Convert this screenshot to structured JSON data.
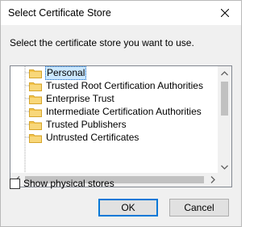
{
  "window": {
    "title": "Select Certificate Store",
    "close_glyph": "✕"
  },
  "prompt": "Select the certificate store you want to use.",
  "tree": {
    "items": [
      {
        "label": "Personal",
        "selected": true,
        "icon": "folder-icon"
      },
      {
        "label": "Trusted Root Certification Authorities",
        "selected": false,
        "icon": "folder-icon"
      },
      {
        "label": "Enterprise Trust",
        "selected": false,
        "icon": "folder-icon"
      },
      {
        "label": "Intermediate Certification Authorities",
        "selected": false,
        "icon": "folder-icon"
      },
      {
        "label": "Trusted Publishers",
        "selected": false,
        "icon": "folder-icon"
      },
      {
        "label": "Untrusted Certificates",
        "selected": false,
        "icon": "folder-icon"
      }
    ]
  },
  "options": {
    "show_physical_label": "Show physical stores",
    "show_physical_checked": false
  },
  "buttons": {
    "ok_label": "OK",
    "cancel_label": "Cancel"
  },
  "colors": {
    "selection_bg": "#cce8ff",
    "accent": "#0078d7",
    "folder": "#f3c34b"
  }
}
